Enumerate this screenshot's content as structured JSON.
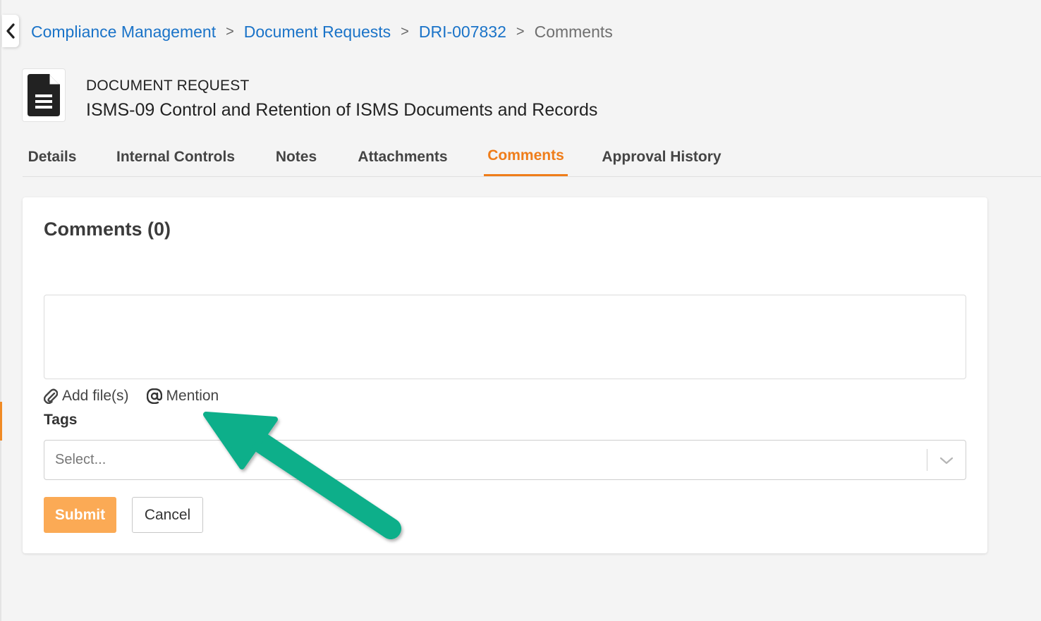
{
  "breadcrumb": {
    "items": [
      "Compliance Management",
      "Document Requests",
      "DRI-007832"
    ],
    "separator": ">",
    "current": "Comments"
  },
  "header": {
    "type_label": "DOCUMENT REQUEST",
    "title": "ISMS-09 Control and Retention of ISMS Documents and Records",
    "icon": "document-icon"
  },
  "tabs": [
    {
      "label": "Details"
    },
    {
      "label": "Internal Controls"
    },
    {
      "label": "Notes"
    },
    {
      "label": "Attachments"
    },
    {
      "label": "Comments",
      "active": true
    },
    {
      "label": "Approval History"
    }
  ],
  "comments": {
    "title": "Comments (0)",
    "input_value": "",
    "add_files_label": "Add file(s)",
    "mention_label": "Mention",
    "tags_label": "Tags",
    "tags_placeholder": "Select...",
    "submit_label": "Submit",
    "cancel_label": "Cancel"
  },
  "colors": {
    "accent": "#ef7d1a",
    "link": "#1a73c8",
    "submit_bg": "#fbaa55",
    "annotation_arrow": "#0aaf8a"
  }
}
